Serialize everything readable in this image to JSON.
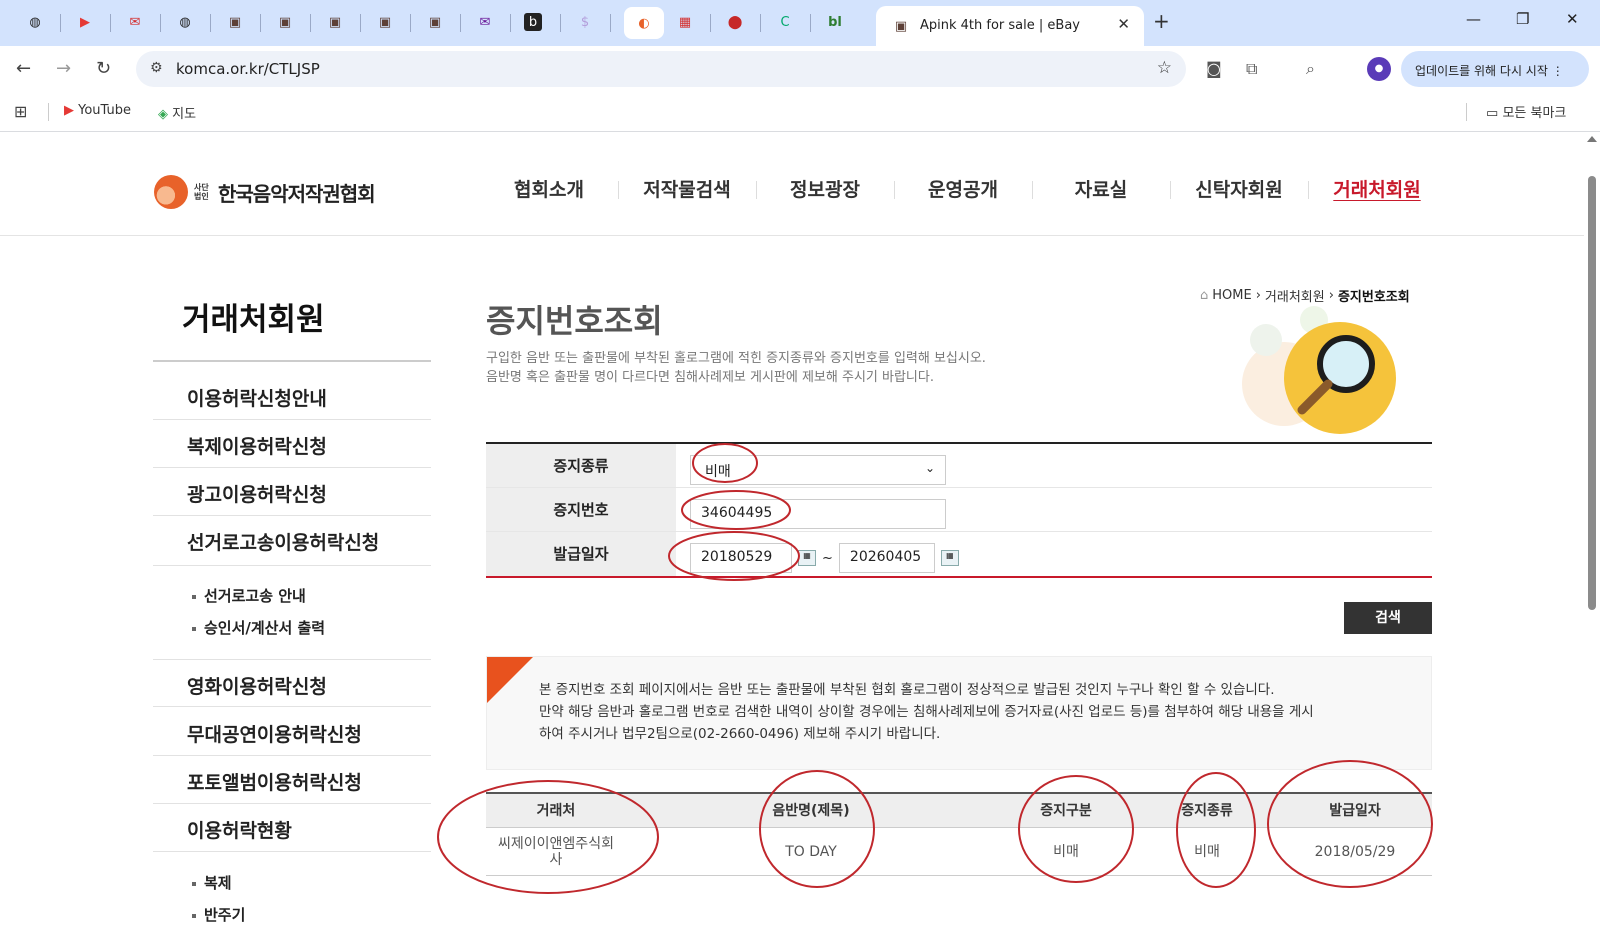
{
  "browser": {
    "active_tab_title": "Apink 4th for sale | eBay",
    "url": "komca.or.kr/CTLJSP",
    "update_button": "업데이트를 위해 다시 시작",
    "bookmarks": [
      {
        "label": "YouTube",
        "icon": "youtube-icon"
      },
      {
        "label": "지도",
        "icon": "maps-icon"
      }
    ],
    "all_bookmarks": "모든 북마크",
    "tab_icons": [
      "globe-icon",
      "youtube-icon",
      "mail-icon",
      "globe-icon",
      "ebay-bag-icon",
      "ebay-bag-icon",
      "ebay-bag-icon",
      "ebay-bag-icon",
      "ebay-bag-icon",
      "mail-icon",
      "b-icon",
      "dollar-icon",
      "logo-icon",
      "calendar-icon",
      "opera-icon",
      "c-icon",
      "bl-icon"
    ]
  },
  "site": {
    "logo_sub": "사단 법인",
    "logo_text": "한국음악저작권협회",
    "nav": [
      "협회소개",
      "저작물검색",
      "정보광장",
      "운영공개",
      "자료실",
      "신탁자회원",
      "거래처회원"
    ],
    "active_nav": "거래처회원"
  },
  "sidebar": {
    "title": "거래처회원",
    "items": [
      "이용허락신청안내",
      "복제이용허락신청",
      "광고이용허락신청",
      "선거로고송이용허락신청"
    ],
    "sub_items_1": [
      "선거로고송 안내",
      "승인서/계산서 출력"
    ],
    "items2": [
      "영화이용허락신청",
      "무대공연이용허락신청",
      "포토앨범이용허락신청",
      "이용허락현황"
    ],
    "sub_items_2": [
      "복제",
      "반주기"
    ]
  },
  "content": {
    "title": "증지번호조회",
    "desc_line1": "구입한 음반 또는 출판물에 부착된 홀로그램에 적힌 증지종류와 증지번호를 입력해 보십시오.",
    "desc_line2": "음반명 혹은 출판물 명이 다르다면 침해사례제보 게시판에 제보해 주시기 바랍니다.",
    "breadcrumb": {
      "home": "HOME",
      "parent": "거래처회원",
      "current": "증지번호조회"
    },
    "form": {
      "type_label": "증지종류",
      "type_value": "비매",
      "number_label": "증지번호",
      "number_value": "34604495",
      "date_label": "발급일자",
      "date_from": "20180529",
      "date_sep": "~",
      "date_to": "20260405"
    },
    "search_button": "검색",
    "notice": [
      "본 증지번호 조회 페이지에서는 음반 또는 출판물에 부착된 협회 홀로그램이 정상적으로 발급된 것인지 누구나 확인 할 수 있습니다.",
      "만약 해당 음반과 홀로그램 번호로 검색한 내역이 상이할 경우에는 침해사례제보에 증거자료(사진 업로드 등)를 첨부하여 해당 내용을 게시",
      "하여 주시거나 법무2팀으로(02-2660-0496) 제보해 주시기 바랍니다."
    ],
    "result": {
      "headers": [
        "거래처",
        "음반명(제목)",
        "증지구분",
        "증지종류",
        "발급일자"
      ],
      "rows": [
        {
          "client_line1": "씨제이이앤엠주식회",
          "client_line2": "사",
          "album": "TO DAY",
          "category": "비매",
          "type": "비매",
          "date": "2018/05/29"
        }
      ]
    }
  },
  "colors": {
    "accent_red": "#c8192b",
    "annotation_red": "#c0282d",
    "logo_orange": "#e8622a"
  }
}
